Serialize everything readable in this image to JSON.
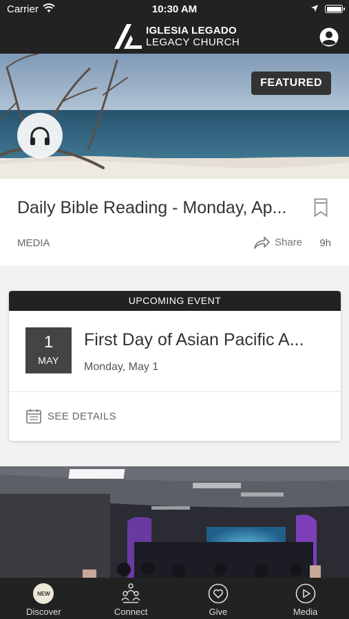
{
  "status_bar": {
    "carrier": "Carrier",
    "time": "10:30 AM"
  },
  "header": {
    "logo_line1": "IGLESIA LEGADO",
    "logo_line2": "LEGACY CHURCH"
  },
  "featured_item": {
    "badge": "FEATURED",
    "title": "Daily Bible Reading - Monday, Ap...",
    "category": "MEDIA",
    "share_label": "Share",
    "age": "9h"
  },
  "event": {
    "header": "UPCOMING EVENT",
    "day": "1",
    "month": "MAY",
    "title": "First Day of Asian Pacific A...",
    "date": "Monday, May 1",
    "details_label": "SEE DETAILS"
  },
  "tabs": [
    {
      "label": "Discover",
      "icon": "new-badge-icon",
      "badge": "NEW"
    },
    {
      "label": "Connect",
      "icon": "connect-people-icon"
    },
    {
      "label": "Give",
      "icon": "heart-circle-icon"
    },
    {
      "label": "Media",
      "icon": "play-circle-icon"
    }
  ]
}
